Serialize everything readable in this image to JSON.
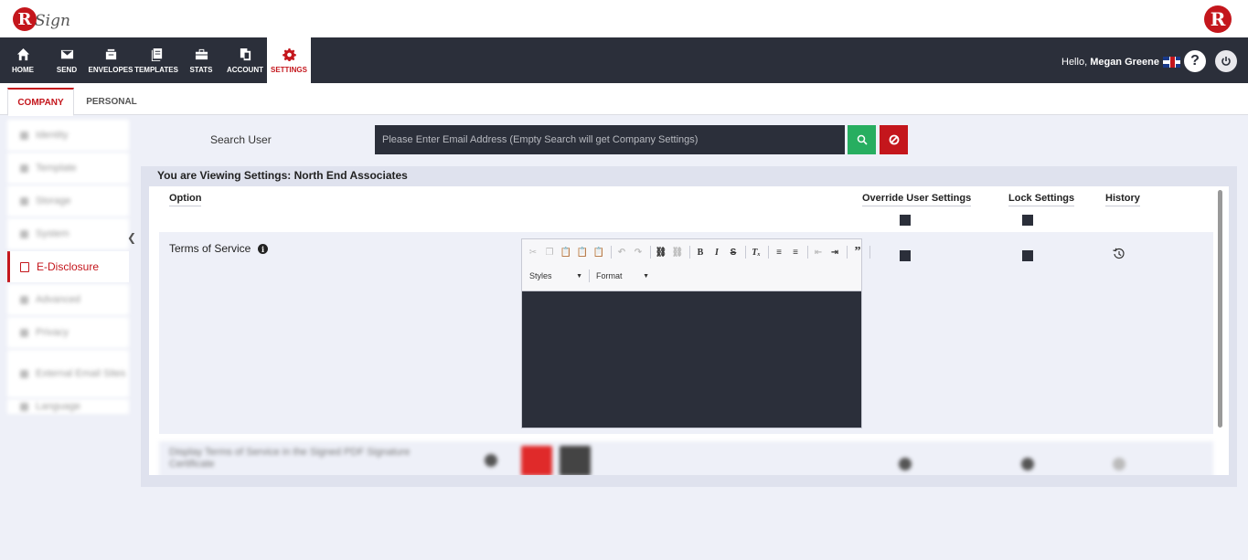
{
  "brand": {
    "logo_letter": "R",
    "logo_text": "Sign",
    "right_logo_letter": "R"
  },
  "nav": {
    "items": [
      {
        "label": "HOME",
        "icon": "home-icon"
      },
      {
        "label": "SEND",
        "icon": "envelope-icon"
      },
      {
        "label": "ENVELOPES",
        "icon": "envelopes-box-icon"
      },
      {
        "label": "TEMPLATES",
        "icon": "templates-icon"
      },
      {
        "label": "STATS",
        "icon": "briefcase-icon"
      },
      {
        "label": "ACCOUNT",
        "icon": "account-icon"
      },
      {
        "label": "SETTINGS",
        "icon": "gear-icon",
        "active": true
      }
    ],
    "hello_prefix": "Hello,",
    "user_name": "Megan Greene",
    "help_label": "?"
  },
  "tabs": [
    {
      "label": "COMPANY",
      "active": true
    },
    {
      "label": "PERSONAL",
      "active": false
    }
  ],
  "sidebar": {
    "items": [
      {
        "label": "Identity"
      },
      {
        "label": "Template"
      },
      {
        "label": "Storage"
      },
      {
        "label": "System"
      },
      {
        "label": "E-Disclosure",
        "active": true
      },
      {
        "label": "Advanced"
      },
      {
        "label": "Privacy"
      },
      {
        "label": "External Email Sites"
      },
      {
        "label": "Language"
      }
    ]
  },
  "search": {
    "label": "Search User",
    "placeholder": "Please Enter Email Address (Empty Search will get Company Settings)"
  },
  "panel": {
    "title": "You are Viewing Settings: North End Associates",
    "headers": {
      "option": "Option",
      "override": "Override User Settings",
      "lock": "Lock Settings",
      "history": "History"
    },
    "rows": [
      {
        "label": "Terms of Service",
        "editor": {
          "styles_label": "Styles",
          "format_label": "Format"
        }
      },
      {
        "label": "Display Terms of Service in the Signed PDF Signature Certificate"
      }
    ]
  },
  "colors": {
    "accent": "#c4161c",
    "nav_bg": "#2b2f3a",
    "search_btn": "#27ae60"
  }
}
